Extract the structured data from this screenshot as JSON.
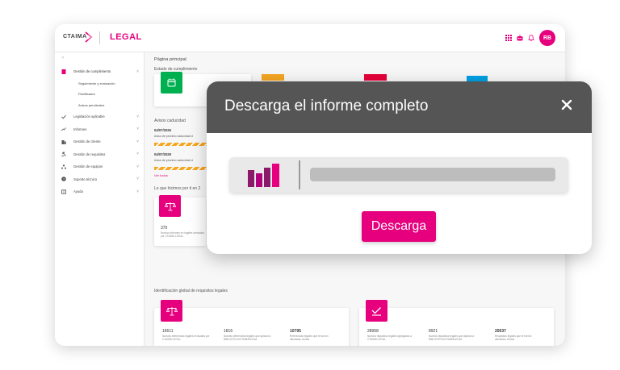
{
  "brand": {
    "name": "CTAIMA",
    "product": "LEGAL",
    "accent": "#e6007e"
  },
  "user": {
    "initials": "RB"
  },
  "topbar": {
    "icons": [
      "grid-icon",
      "robot-icon",
      "bell-icon"
    ]
  },
  "sidebar": {
    "collapse": "‹",
    "items": [
      {
        "label": "Gestión de cumplimiento",
        "icon": "document-icon",
        "expanded": true
      },
      {
        "label": "Legislación aplicable",
        "icon": "check-icon"
      },
      {
        "label": "Informes",
        "icon": "trend-icon"
      },
      {
        "label": "Gestión de cliente",
        "icon": "building-icon"
      },
      {
        "label": "Gestión de requisitos",
        "icon": "gavel-icon"
      },
      {
        "label": "Gestión de equipos",
        "icon": "team-icon"
      },
      {
        "label": "Soporte técnico",
        "icon": "help-icon"
      },
      {
        "label": "Ayuda",
        "icon": "book-icon"
      }
    ],
    "subitems": [
      "Seguimiento y evaluación",
      "Planificador",
      "Avisos pendientes"
    ]
  },
  "main": {
    "page_title": "Página principal",
    "status_title": "Estado de cumplimiento",
    "status_colors": [
      "#00b050",
      "#f5a623",
      "#e6003a",
      "#00a0e3"
    ],
    "notices_title": "Avisos caducidad",
    "notices": [
      {
        "date": "04/07/2026",
        "text": "Aviso de próximo caducidad d"
      },
      {
        "date": "04/07/2029",
        "text": "Aviso de próximo caducidad d"
      }
    ],
    "see_all": "Ver todos",
    "last_section_title": "Lo que hicimos por ti en 2",
    "last_value": "370",
    "last_caption": "Nuevos informes en legales revisados por CTAIMA LEGAL",
    "global_title": "Identificación global de requisitos legales",
    "card_a": {
      "stats": [
        {
          "value": "16611",
          "caption": "Nuevas referencias legales revisadas por CTAIMA LEGAL"
        },
        {
          "value": "1816",
          "caption": "Nuevas referencias legales que aplican a BIBLIOTECA/CTAIMALEGAL"
        },
        {
          "value": "10795",
          "caption": "Referencias legales que le fueron afectadas revisar"
        }
      ]
    },
    "card_b": {
      "stats": [
        {
          "value": "28958",
          "caption": "Nuevos requisitos legales agregados a CTAIMA LEGAL"
        },
        {
          "value": "8921",
          "caption": "Nuevos requisitos legales que aplican a BIBLIOTECA/CTAIMALEGAL"
        },
        {
          "value": "20037",
          "caption": "Requisitos legales que le fueron afectados revisar"
        }
      ]
    }
  },
  "modal": {
    "title": "Descarga el informe completo",
    "close": "close-icon",
    "progress": 0,
    "button": "Descarga"
  }
}
